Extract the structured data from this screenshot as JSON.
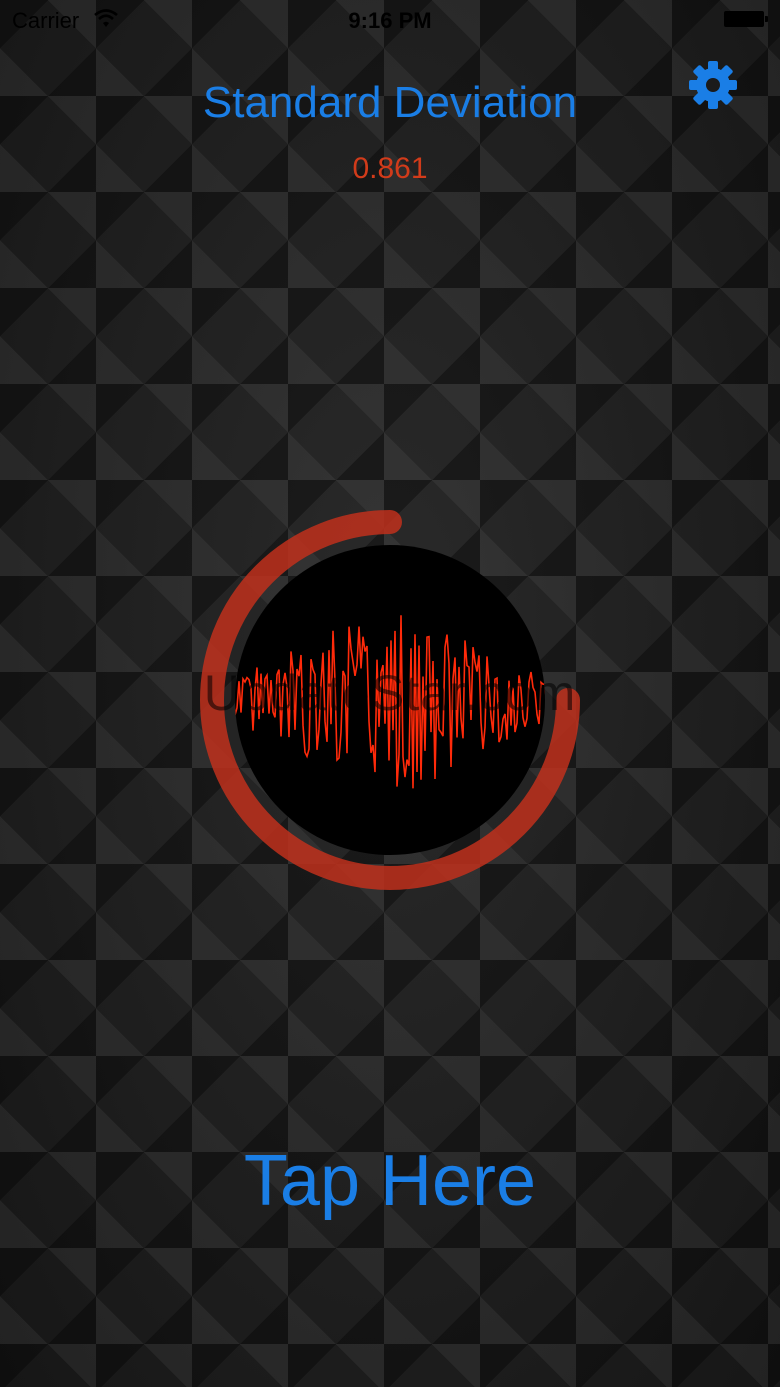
{
  "status_bar": {
    "carrier": "Carrier",
    "time": "9:16 PM"
  },
  "header": {
    "title": "Standard Deviation",
    "value": "0.861"
  },
  "meter": {
    "progress": 0.75,
    "accent": "#c0301c",
    "wave_color": "#ff2a0a"
  },
  "watermark": "UpdateStar.com",
  "action": {
    "label": "Tap Here"
  },
  "colors": {
    "accent_blue": "#1a7ee6",
    "value_red": "#d13b1a"
  },
  "icons": {
    "settings": "gear-icon"
  }
}
